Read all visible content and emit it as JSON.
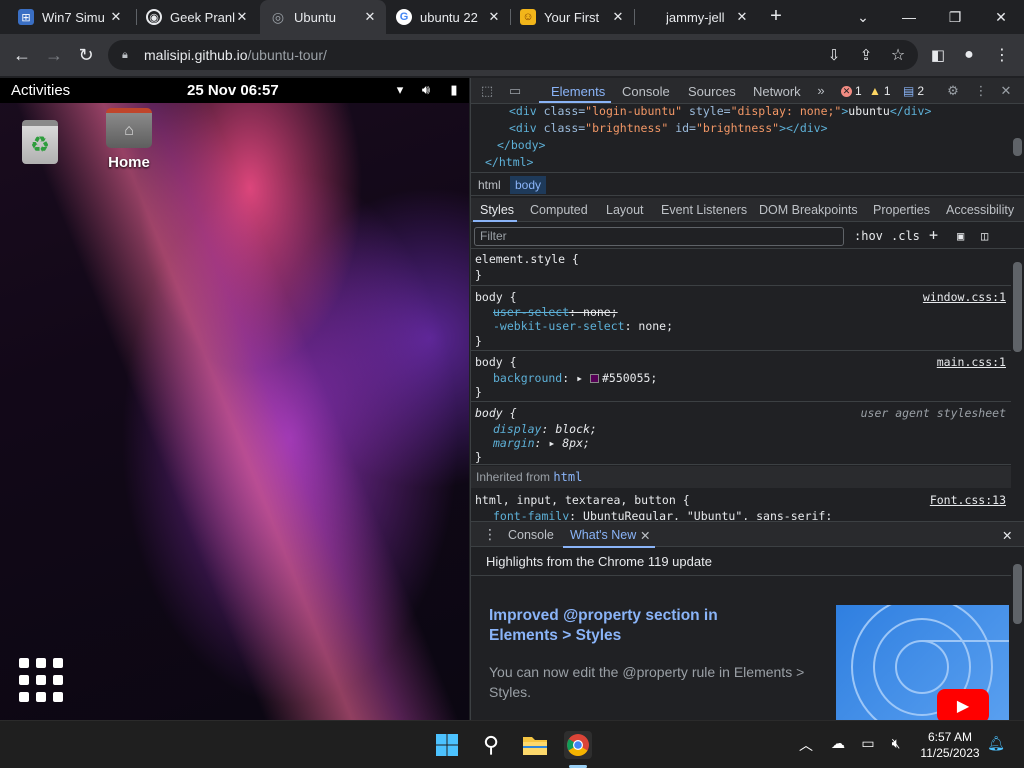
{
  "browser": {
    "tabs": [
      {
        "title": "Win7 Simu",
        "favicon": "win7-icon"
      },
      {
        "title": "Geek Pranl",
        "favicon": "geek-icon"
      },
      {
        "title": "Ubuntu",
        "favicon": "ubuntu-icon",
        "active": true
      },
      {
        "title": "ubuntu 22",
        "favicon": "google-icon"
      },
      {
        "title": "Your First",
        "favicon": "firstdev-icon"
      },
      {
        "title": "jammy-jell",
        "favicon": ""
      }
    ],
    "url_host": "malisipi.github.io",
    "url_path": "/ubuntu-tour/"
  },
  "ubuntu": {
    "activities": "Activities",
    "clock": "25 Nov 06:57",
    "home_label": "Home"
  },
  "devtools": {
    "tabs": [
      "Elements",
      "Console",
      "Sources",
      "Network"
    ],
    "errors": "1",
    "warnings": "1",
    "messages": "2",
    "dom_lines": {
      "l1_open": "<div ",
      "l1_attr1": "class=",
      "l1_val1": "\"login-ubuntu\"",
      "l1_attr2": " style=",
      "l1_val2": "\"display: none;\"",
      "l1_close": ">",
      "l1_text": "ubuntu",
      "l1_end": "</div>",
      "l2_open": "<div ",
      "l2_attr1": "class=",
      "l2_val1": "\"brightness\"",
      "l2_attr2": " id=",
      "l2_val2": "\"brightness\"",
      "l2_end": "></div>",
      "l3": "</body>",
      "l4": "</html>"
    },
    "breadcrumbs": [
      "html",
      "body"
    ],
    "subtabs": [
      "Styles",
      "Computed",
      "Layout",
      "Event Listeners",
      "DOM Breakpoints",
      "Properties",
      "Accessibility"
    ],
    "filter_placeholder": "Filter",
    "hov": ":hov",
    "cls": ".cls",
    "rules": {
      "element_style": "element.style {",
      "close": "}",
      "r1_sel": "body {",
      "r1_src": "window.css:1",
      "r1_p1": "user-select",
      "r1_v1": ": none;",
      "r1_p2": "-webkit-user-select",
      "r1_v2": ": none;",
      "r2_sel": "body {",
      "r2_src": "main.css:1",
      "r2_p1": "background",
      "r2_v1": "#550055;",
      "r3_sel": "body {",
      "r3_src": "user agent stylesheet",
      "r3_p1": "display",
      "r3_v1": ": block;",
      "r3_p2": "margin",
      "r3_v2": "8px;",
      "inherited_label": "Inherited from",
      "inherited_tag": "html",
      "r4_sel": "html, input, textarea, button {",
      "r4_src": "Font.css:13",
      "r4_p1": "font-family",
      "r4_v1": ": UbuntuRegular, \"Ubuntu\", sans-serif;"
    },
    "drawer_tabs": [
      "Console",
      "What's New"
    ],
    "whats_new": {
      "highlights": "Highlights from the Chrome 119 update",
      "title": "Improved @property section in Elements > Styles",
      "body": "You can now edit the @property rule in Elements > Styles."
    }
  },
  "taskbar": {
    "time": "6:57 AM",
    "date": "11/25/2023"
  },
  "colors": {
    "accent": "#8ab4f8",
    "page_bg": "#550055"
  }
}
